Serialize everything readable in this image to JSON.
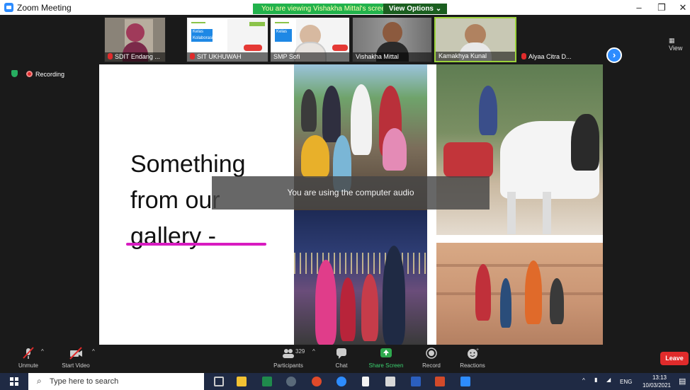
{
  "window": {
    "title": "Zoom Meeting",
    "minimize": "–",
    "restore": "❐",
    "close": "✕"
  },
  "share_banner": {
    "message": "You are viewing Vishakha Mittal's screen",
    "view_options": "View Options ⌄"
  },
  "participants_strip": [
    {
      "name": "SDIT Endang ...",
      "muted": true
    },
    {
      "name": "SIT UKHUWAH",
      "muted": true
    },
    {
      "name": "SMP Sofi",
      "muted": false
    },
    {
      "name": "Vishakha Mittal",
      "muted": false
    },
    {
      "name": "Kamakhya Kunal",
      "muted": false
    },
    {
      "name": "Alyaa Citra D...",
      "muted": true
    }
  ],
  "slide_thumb_text": {
    "line1": "Kelas",
    "line2": "Kolaborasi"
  },
  "view_label": "View",
  "recording_label": "Recording",
  "slide": {
    "title_line1": "Something",
    "title_line2": "from our",
    "title_line3": "gallery -"
  },
  "audio_toast": "You are using the computer audio",
  "toolbar": {
    "unmute": "Unmute",
    "start_video": "Start Video",
    "participants": "Participants",
    "participant_count": "329",
    "chat": "Chat",
    "share_screen": "Share Screen",
    "record": "Record",
    "reactions": "Reactions",
    "leave": "Leave"
  },
  "taskbar": {
    "search_placeholder": "Type here to search",
    "language": "ENG",
    "time": "13:13",
    "date": "10/03/2021"
  },
  "colors": {
    "zoom_blue": "#2d8cff",
    "share_green": "#22b24c",
    "leave_red": "#e02b2b",
    "underline_magenta": "#d81bc0"
  }
}
